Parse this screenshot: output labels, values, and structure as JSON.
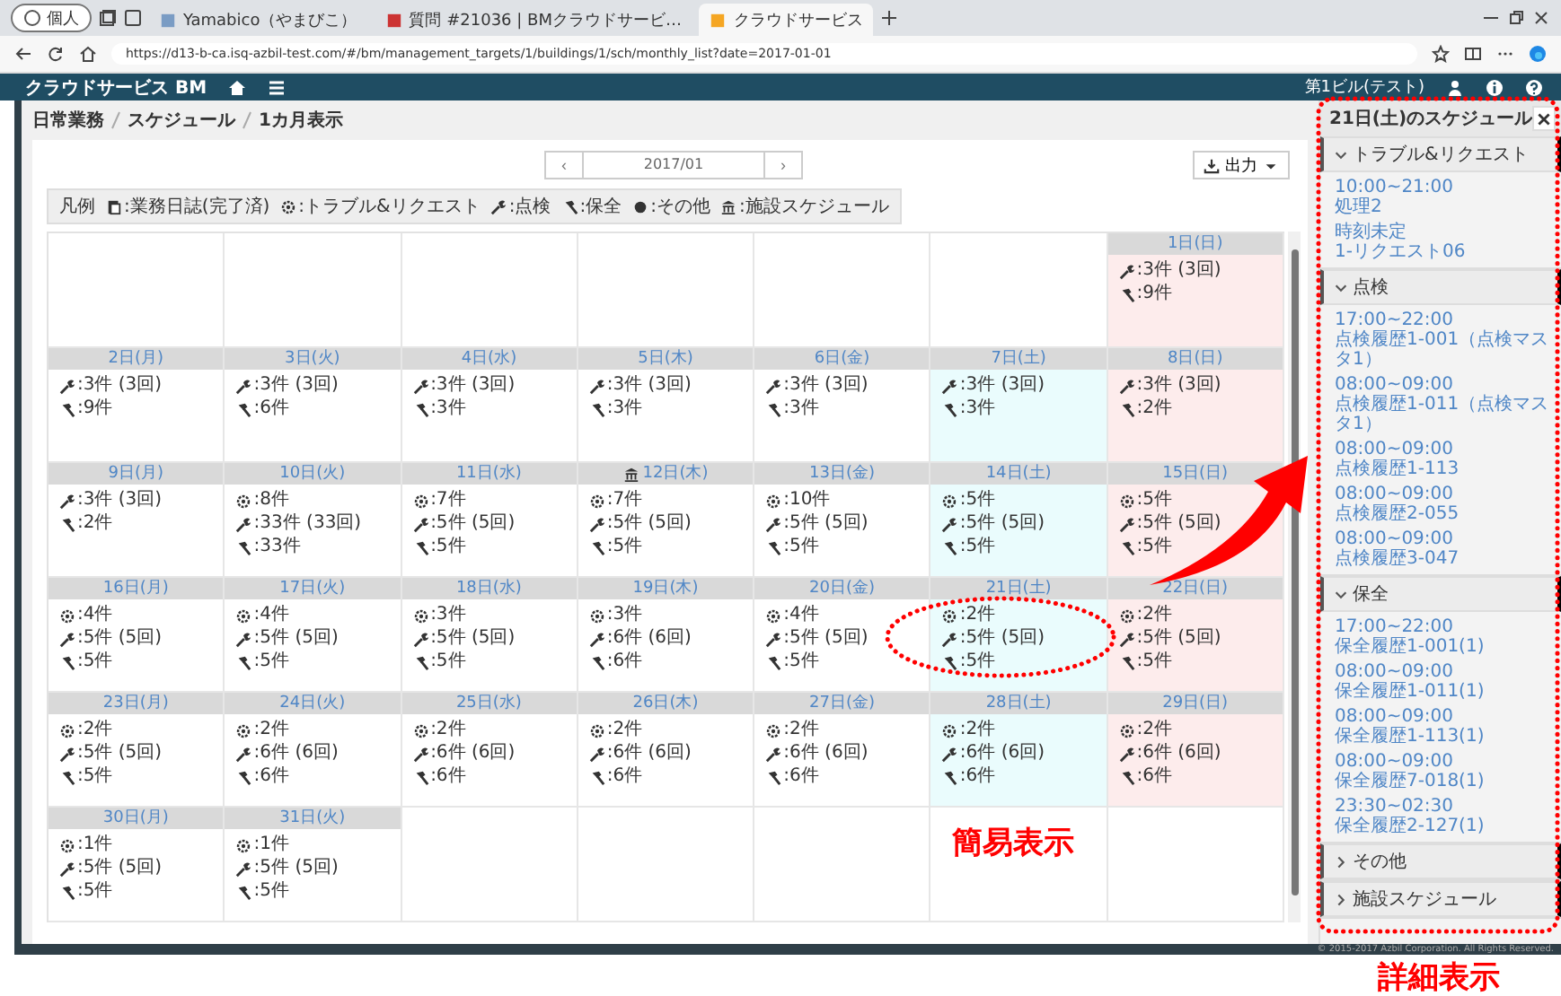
{
  "browser": {
    "profile": "個人",
    "tabs": [
      {
        "title": "Yamabico（やまびこ）",
        "selected": false
      },
      {
        "title": "質問 #21036 | BMクラウドサービ…",
        "selected": false
      },
      {
        "title": "クラウドサービス",
        "selected": true
      }
    ],
    "url": "https://d13-b-ca.isq-azbil-test.com/#/bm/management_targets/1/buildings/1/sch/monthly_list?date=2017-01-01"
  },
  "app_header": {
    "title": "クラウドサービス BM",
    "building": "第1ビル(テスト)"
  },
  "breadcrumb": [
    "日常業務",
    "スケジュール",
    "1カ月表示"
  ],
  "month_nav": {
    "prev": "‹",
    "month": "2017/01",
    "next": "›"
  },
  "output_button": "出力",
  "legend": {
    "title": "凡例",
    "items": [
      {
        "kind": "journal",
        "label": ":業務日誌(完了済)"
      },
      {
        "kind": "trouble",
        "label": ":トラブル&リクエスト"
      },
      {
        "kind": "inspection",
        "label": ":点検"
      },
      {
        "kind": "maintenance",
        "label": ":保全"
      },
      {
        "kind": "other",
        "label": ":その他"
      },
      {
        "kind": "facility",
        "label": ":施設スケジュール"
      }
    ]
  },
  "days": [
    {
      "kind": "blank"
    },
    {
      "kind": "blank"
    },
    {
      "kind": "blank"
    },
    {
      "kind": "blank"
    },
    {
      "kind": "blank"
    },
    {
      "kind": "blank"
    },
    {
      "kind": "sunday",
      "label": "1日(日)",
      "facility": false,
      "lines": [
        {
          "kind": "inspection",
          "text": ":3件 (3回)"
        },
        {
          "kind": "maintenance",
          "text": ":9件"
        }
      ]
    },
    {
      "kind": "weekday",
      "label": "2日(月)",
      "facility": false,
      "lines": [
        {
          "kind": "inspection",
          "text": ":3件 (3回)"
        },
        {
          "kind": "maintenance",
          "text": ":9件"
        }
      ]
    },
    {
      "kind": "weekday",
      "label": "3日(火)",
      "facility": false,
      "lines": [
        {
          "kind": "inspection",
          "text": ":3件 (3回)"
        },
        {
          "kind": "maintenance",
          "text": ":6件"
        }
      ]
    },
    {
      "kind": "weekday",
      "label": "4日(水)",
      "facility": false,
      "lines": [
        {
          "kind": "inspection",
          "text": ":3件 (3回)"
        },
        {
          "kind": "maintenance",
          "text": ":3件"
        }
      ]
    },
    {
      "kind": "weekday",
      "label": "5日(木)",
      "facility": false,
      "lines": [
        {
          "kind": "inspection",
          "text": ":3件 (3回)"
        },
        {
          "kind": "maintenance",
          "text": ":3件"
        }
      ]
    },
    {
      "kind": "weekday",
      "label": "6日(金)",
      "facility": false,
      "lines": [
        {
          "kind": "inspection",
          "text": ":3件 (3回)"
        },
        {
          "kind": "maintenance",
          "text": ":3件"
        }
      ]
    },
    {
      "kind": "saturday",
      "label": "7日(土)",
      "facility": false,
      "lines": [
        {
          "kind": "inspection",
          "text": ":3件 (3回)"
        },
        {
          "kind": "maintenance",
          "text": ":3件"
        }
      ]
    },
    {
      "kind": "sunday",
      "label": "8日(日)",
      "facility": false,
      "lines": [
        {
          "kind": "inspection",
          "text": ":3件 (3回)"
        },
        {
          "kind": "maintenance",
          "text": ":2件"
        }
      ]
    },
    {
      "kind": "weekday",
      "label": "9日(月)",
      "facility": false,
      "lines": [
        {
          "kind": "inspection",
          "text": ":3件 (3回)"
        },
        {
          "kind": "maintenance",
          "text": ":2件"
        }
      ]
    },
    {
      "kind": "weekday",
      "label": "10日(火)",
      "facility": false,
      "lines": [
        {
          "kind": "trouble",
          "text": ":8件"
        },
        {
          "kind": "inspection",
          "text": ":33件 (33回)"
        },
        {
          "kind": "maintenance",
          "text": ":33件"
        }
      ]
    },
    {
      "kind": "weekday",
      "label": "11日(水)",
      "facility": false,
      "lines": [
        {
          "kind": "trouble",
          "text": ":7件"
        },
        {
          "kind": "inspection",
          "text": ":5件 (5回)"
        },
        {
          "kind": "maintenance",
          "text": ":5件"
        }
      ]
    },
    {
      "kind": "weekday",
      "label": "12日(木)",
      "facility": true,
      "lines": [
        {
          "kind": "trouble",
          "text": ":7件"
        },
        {
          "kind": "inspection",
          "text": ":5件 (5回)"
        },
        {
          "kind": "maintenance",
          "text": ":5件"
        }
      ]
    },
    {
      "kind": "weekday",
      "label": "13日(金)",
      "facility": false,
      "lines": [
        {
          "kind": "trouble",
          "text": ":10件"
        },
        {
          "kind": "inspection",
          "text": ":5件 (5回)"
        },
        {
          "kind": "maintenance",
          "text": ":5件"
        }
      ]
    },
    {
      "kind": "saturday",
      "label": "14日(土)",
      "facility": false,
      "lines": [
        {
          "kind": "trouble",
          "text": ":5件"
        },
        {
          "kind": "inspection",
          "text": ":5件 (5回)"
        },
        {
          "kind": "maintenance",
          "text": ":5件"
        }
      ]
    },
    {
      "kind": "sunday",
      "label": "15日(日)",
      "facility": false,
      "lines": [
        {
          "kind": "trouble",
          "text": ":5件"
        },
        {
          "kind": "inspection",
          "text": ":5件 (5回)"
        },
        {
          "kind": "maintenance",
          "text": ":5件"
        }
      ]
    },
    {
      "kind": "weekday",
      "label": "16日(月)",
      "facility": false,
      "lines": [
        {
          "kind": "trouble",
          "text": ":4件"
        },
        {
          "kind": "inspection",
          "text": ":5件 (5回)"
        },
        {
          "kind": "maintenance",
          "text": ":5件"
        }
      ]
    },
    {
      "kind": "weekday",
      "label": "17日(火)",
      "facility": false,
      "lines": [
        {
          "kind": "trouble",
          "text": ":4件"
        },
        {
          "kind": "inspection",
          "text": ":5件 (5回)"
        },
        {
          "kind": "maintenance",
          "text": ":5件"
        }
      ]
    },
    {
      "kind": "weekday",
      "label": "18日(水)",
      "facility": false,
      "lines": [
        {
          "kind": "trouble",
          "text": ":3件"
        },
        {
          "kind": "inspection",
          "text": ":5件 (5回)"
        },
        {
          "kind": "maintenance",
          "text": ":5件"
        }
      ]
    },
    {
      "kind": "weekday",
      "label": "19日(木)",
      "facility": false,
      "lines": [
        {
          "kind": "trouble",
          "text": ":3件"
        },
        {
          "kind": "inspection",
          "text": ":6件 (6回)"
        },
        {
          "kind": "maintenance",
          "text": ":6件"
        }
      ]
    },
    {
      "kind": "weekday",
      "label": "20日(金)",
      "facility": false,
      "lines": [
        {
          "kind": "trouble",
          "text": ":4件"
        },
        {
          "kind": "inspection",
          "text": ":5件 (5回)"
        },
        {
          "kind": "maintenance",
          "text": ":5件"
        }
      ]
    },
    {
      "kind": "saturday",
      "label": "21日(土)",
      "facility": false,
      "lines": [
        {
          "kind": "trouble",
          "text": ":2件"
        },
        {
          "kind": "inspection",
          "text": ":5件 (5回)"
        },
        {
          "kind": "maintenance",
          "text": ":5件"
        }
      ]
    },
    {
      "kind": "sunday",
      "label": "22日(日)",
      "facility": false,
      "lines": [
        {
          "kind": "trouble",
          "text": ":2件"
        },
        {
          "kind": "inspection",
          "text": ":5件 (5回)"
        },
        {
          "kind": "maintenance",
          "text": ":5件"
        }
      ]
    },
    {
      "kind": "weekday",
      "label": "23日(月)",
      "facility": false,
      "lines": [
        {
          "kind": "trouble",
          "text": ":2件"
        },
        {
          "kind": "inspection",
          "text": ":5件 (5回)"
        },
        {
          "kind": "maintenance",
          "text": ":5件"
        }
      ]
    },
    {
      "kind": "weekday",
      "label": "24日(火)",
      "facility": false,
      "lines": [
        {
          "kind": "trouble",
          "text": ":2件"
        },
        {
          "kind": "inspection",
          "text": ":6件 (6回)"
        },
        {
          "kind": "maintenance",
          "text": ":6件"
        }
      ]
    },
    {
      "kind": "weekday",
      "label": "25日(水)",
      "facility": false,
      "lines": [
        {
          "kind": "trouble",
          "text": ":2件"
        },
        {
          "kind": "inspection",
          "text": ":6件 (6回)"
        },
        {
          "kind": "maintenance",
          "text": ":6件"
        }
      ]
    },
    {
      "kind": "weekday",
      "label": "26日(木)",
      "facility": false,
      "lines": [
        {
          "kind": "trouble",
          "text": ":2件"
        },
        {
          "kind": "inspection",
          "text": ":6件 (6回)"
        },
        {
          "kind": "maintenance",
          "text": ":6件"
        }
      ]
    },
    {
      "kind": "weekday",
      "label": "27日(金)",
      "facility": false,
      "lines": [
        {
          "kind": "trouble",
          "text": ":2件"
        },
        {
          "kind": "inspection",
          "text": ":6件 (6回)"
        },
        {
          "kind": "maintenance",
          "text": ":6件"
        }
      ]
    },
    {
      "kind": "saturday",
      "label": "28日(土)",
      "facility": false,
      "lines": [
        {
          "kind": "trouble",
          "text": ":2件"
        },
        {
          "kind": "inspection",
          "text": ":6件 (6回)"
        },
        {
          "kind": "maintenance",
          "text": ":6件"
        }
      ]
    },
    {
      "kind": "sunday",
      "label": "29日(日)",
      "facility": false,
      "lines": [
        {
          "kind": "trouble",
          "text": ":2件"
        },
        {
          "kind": "inspection",
          "text": ":6件 (6回)"
        },
        {
          "kind": "maintenance",
          "text": ":6件"
        }
      ]
    },
    {
      "kind": "weekday",
      "label": "30日(月)",
      "facility": false,
      "lines": [
        {
          "kind": "trouble",
          "text": ":1件"
        },
        {
          "kind": "inspection",
          "text": ":5件 (5回)"
        },
        {
          "kind": "maintenance",
          "text": ":5件"
        }
      ]
    },
    {
      "kind": "weekday",
      "label": "31日(火)",
      "facility": false,
      "lines": [
        {
          "kind": "trouble",
          "text": ":1件"
        },
        {
          "kind": "inspection",
          "text": ":5件 (5回)"
        },
        {
          "kind": "maintenance",
          "text": ":5件"
        }
      ]
    },
    {
      "kind": "blank"
    },
    {
      "kind": "blank"
    },
    {
      "kind": "blank"
    },
    {
      "kind": "blank"
    },
    {
      "kind": "blank"
    }
  ],
  "detail_panel": {
    "title": "21日(土)のスケジュール",
    "sections": [
      {
        "title": "トラブル&リクエスト",
        "expanded": true,
        "entries": [
          {
            "time": "10:00~21:00",
            "title": "処理2"
          },
          {
            "time": "時刻未定",
            "title": "1-リクエスト06"
          }
        ]
      },
      {
        "title": "点検",
        "expanded": true,
        "entries": [
          {
            "time": "17:00~22:00",
            "title": "点検履歴1-001（点検マスタ1）"
          },
          {
            "time": "08:00~09:00",
            "title": "点検履歴1-011（点検マスタ1）"
          },
          {
            "time": "08:00~09:00",
            "title": "点検履歴1-113"
          },
          {
            "time": "08:00~09:00",
            "title": "点検履歴2-055"
          },
          {
            "time": "08:00~09:00",
            "title": "点検履歴3-047"
          }
        ]
      },
      {
        "title": "保全",
        "expanded": true,
        "entries": [
          {
            "time": "17:00~22:00",
            "title": "保全履歴1-001(1)"
          },
          {
            "time": "08:00~09:00",
            "title": "保全履歴1-011(1)"
          },
          {
            "time": "08:00~09:00",
            "title": "保全履歴1-113(1)"
          },
          {
            "time": "08:00~09:00",
            "title": "保全履歴7-018(1)"
          },
          {
            "time": "23:30~02:30",
            "title": "保全履歴2-127(1)"
          }
        ]
      },
      {
        "title": "その他",
        "expanded": false
      },
      {
        "title": "施設スケジュール",
        "expanded": false
      }
    ]
  },
  "footer": "© 2015-2017 Azbil Corporation. All Rights Reserved.",
  "annotations": [
    {
      "kind": "simple",
      "label": "簡易表示"
    },
    {
      "kind": "detail",
      "label": "詳細表示"
    }
  ]
}
